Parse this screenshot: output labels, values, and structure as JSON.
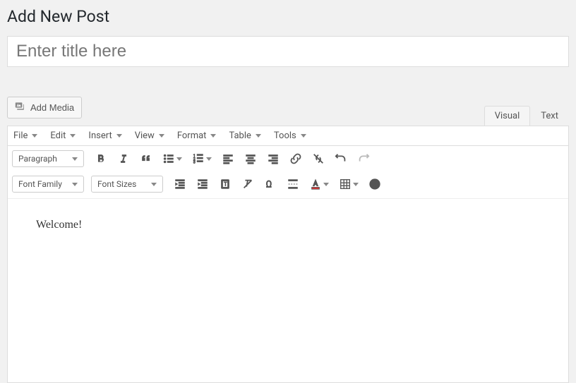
{
  "page_header": "Add New Post",
  "title_placeholder": "Enter title here",
  "title_value": "",
  "add_media_label": "Add Media",
  "tabs": {
    "visual": "Visual",
    "text": "Text",
    "active": "visual"
  },
  "menubar": [
    "File",
    "Edit",
    "Insert",
    "View",
    "Format",
    "Table",
    "Tools"
  ],
  "format_dropdown": "Paragraph",
  "font_family_dropdown": "Font Family",
  "font_sizes_dropdown": "Font Sizes",
  "content": "Welcome!"
}
